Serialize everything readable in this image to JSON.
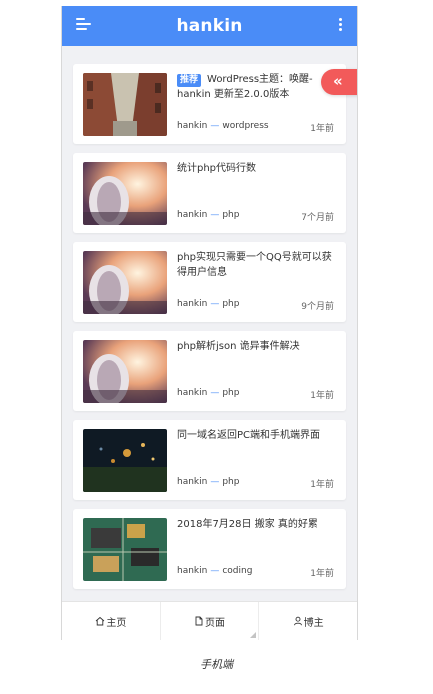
{
  "header": {
    "title": "hankin"
  },
  "posts": [
    {
      "badge": "推荐",
      "title": "WordPress主题：唤醒-hankin 更新至2.0.0版本",
      "author": "hankin",
      "category": "wordpress",
      "time": "1年前"
    },
    {
      "title": "统计php代码行数",
      "author": "hankin",
      "category": "php",
      "time": "7个月前"
    },
    {
      "title": "php实现只需要一个QQ号就可以获得用户信息",
      "author": "hankin",
      "category": "php",
      "time": "9个月前"
    },
    {
      "title": "php解析json 诡异事件解决",
      "author": "hankin",
      "category": "php",
      "time": "1年前"
    },
    {
      "title": "同一域名返回PC端和手机端界面",
      "author": "hankin",
      "category": "php",
      "time": "1年前"
    },
    {
      "title": "2018年7月28日 搬家 真的好累",
      "author": "hankin",
      "category": "coding",
      "time": "1年前"
    }
  ],
  "float_button": {
    "label": "«"
  },
  "tabs": [
    {
      "label": "主页",
      "icon": "home-icon"
    },
    {
      "label": "页面",
      "icon": "page-icon"
    },
    {
      "label": "博主",
      "icon": "user-icon"
    }
  ],
  "caption": "手机端",
  "colors": {
    "primary": "#4a8cf7",
    "accent": "#f25a5a"
  }
}
